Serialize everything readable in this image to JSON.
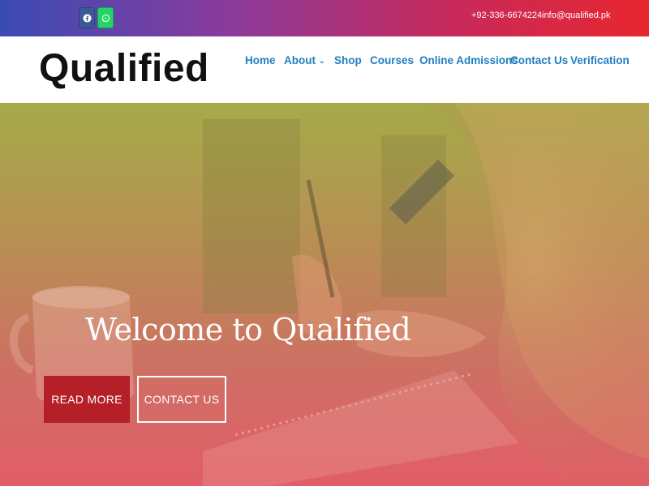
{
  "topbar": {
    "social": [
      {
        "name": "facebook-icon",
        "color": "#3b5998"
      },
      {
        "name": "whatsapp-icon",
        "color": "#25d366"
      }
    ],
    "phone": "+92-336-6674224",
    "email": "info@qualified.pk"
  },
  "header": {
    "logo": "Qualified",
    "nav": {
      "home": "Home",
      "about": "About",
      "shop": "Shop",
      "courses": "Courses",
      "admissions": "Online Admissions",
      "contact": "Contact Us",
      "verification": "Verification"
    }
  },
  "hero": {
    "title": "Welcome to Qualified",
    "read_more": "READ MORE",
    "contact_us": "CONTACT US"
  },
  "colors": {
    "accent": "#1f7fc2",
    "button_red": "#b51f28"
  }
}
